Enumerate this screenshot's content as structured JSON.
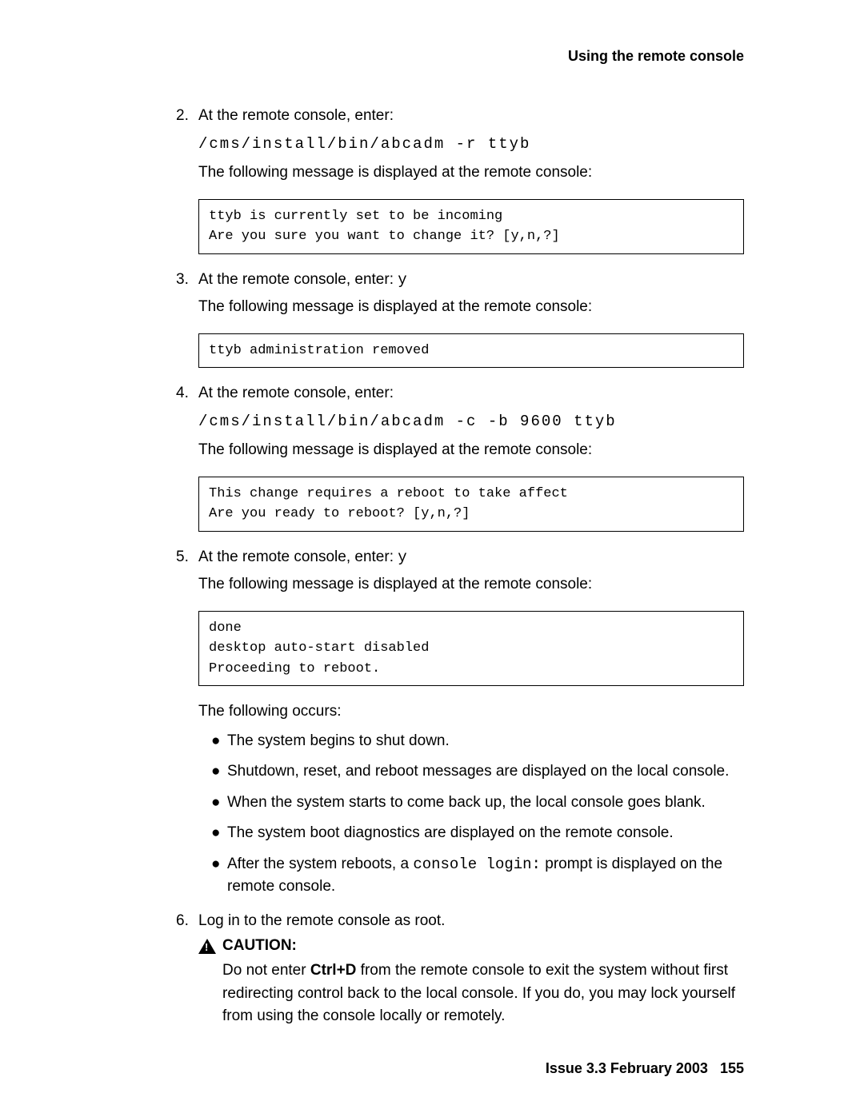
{
  "header": {
    "title": "Using the remote console"
  },
  "steps": {
    "s2": {
      "num": "2.",
      "text": "At the remote console, enter:",
      "cmd": "/cms/install/bin/abcadm -r ttyb",
      "msg": "The following message is displayed at the remote console:",
      "code": "ttyb is currently set to be incoming\nAre you sure you want to change it? [y,n,?]"
    },
    "s3": {
      "num": "3.",
      "prefix": "At the remote console, enter: ",
      "inline": "y",
      "msg": "The following message is displayed at the remote console:",
      "code": "ttyb administration removed"
    },
    "s4": {
      "num": "4.",
      "text": "At the remote console, enter:",
      "cmd": "/cms/install/bin/abcadm -c -b 9600 ttyb",
      "msg": "The following message is displayed at the remote console:",
      "code": "This change requires a reboot to take affect\nAre you ready to reboot? [y,n,?]"
    },
    "s5": {
      "num": "5.",
      "prefix": "At the remote console, enter: ",
      "inline": "y",
      "msg": "The following message is displayed at the remote console:",
      "code": "done\ndesktop auto-start disabled\nProceeding to reboot.",
      "follow": "The following occurs:",
      "bullets": {
        "b1": "The system begins to shut down.",
        "b2": "Shutdown, reset, and reboot messages are displayed on the local console.",
        "b3": "When the system starts to come back up, the local console goes blank.",
        "b4": "The system boot diagnostics are displayed on the remote console.",
        "b5a": "After the system reboots, a ",
        "b5b": "console login:",
        "b5c": " prompt is displayed on the remote console."
      }
    },
    "s6": {
      "num": "6.",
      "text": "Log in to the remote console as root."
    }
  },
  "caution": {
    "label": "CAUTION:",
    "t1": "Do not enter ",
    "bold": "Ctrl+D",
    "t2": " from the remote console to exit the system without first redirecting control back to the local console. If you do, you may lock yourself from using the console locally or remotely."
  },
  "footer": {
    "issue": "Issue 3.3  February 2003",
    "page": "155"
  }
}
